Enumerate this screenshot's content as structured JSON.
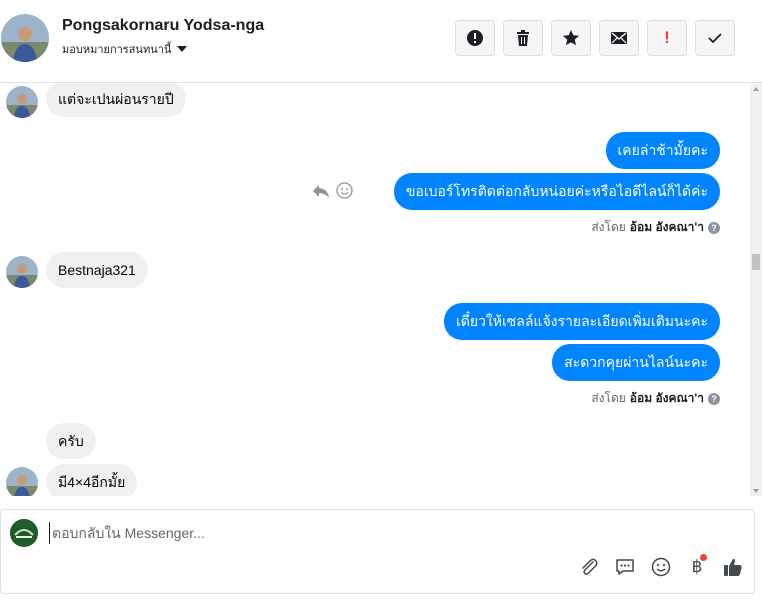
{
  "header": {
    "contact_name": "Pongsakornaru Yodsa-nga",
    "assign_label": "มอบหมายการสนทนานี้",
    "actions": [
      {
        "icon": "alert-circle-icon",
        "name": "report-button"
      },
      {
        "icon": "trash-icon",
        "name": "delete-button"
      },
      {
        "icon": "star-icon",
        "name": "star-button"
      },
      {
        "icon": "envelope-icon",
        "name": "mark-unread-button"
      },
      {
        "icon": "exclamation-icon",
        "name": "spam-button",
        "label": "!"
      },
      {
        "icon": "check-icon",
        "name": "done-button"
      }
    ]
  },
  "thread": {
    "messages": [
      {
        "dir": "in",
        "text": "แต่จะเปนผ่อนรายปี"
      },
      {
        "dir": "out",
        "text": "เคยล่าช้ามั้ยคะ"
      },
      {
        "dir": "out",
        "text": "ขอเบอร์โทรติดต่อกลับหน่อยค่ะหรือไอดีไลน์ก็ได้ค่ะ"
      },
      {
        "dir": "in",
        "text": "Bestnaja321"
      },
      {
        "dir": "out",
        "text": "เดี๋ยวให้เซลล์แจ้งรายละเอียดเพิ่มเติมนะคะ"
      },
      {
        "dir": "out",
        "text": "สะดวกคุยผ่านไลน์นะคะ"
      },
      {
        "dir": "in",
        "text": "ครับ"
      },
      {
        "dir": "in",
        "text": "มี4×4อีกมั้ย"
      }
    ],
    "sent_by": {
      "prefix": "ส่งโดย",
      "name": "อ้อม อังคณา'า"
    },
    "sent_by_2": {
      "prefix": "ส่งโดย",
      "name": "อ้อม อังคณา'า"
    },
    "help_glyph": "?"
  },
  "composer": {
    "placeholder": "ตอบกลับใน Messenger...",
    "tools": [
      "paperclip-icon",
      "saved-replies-icon",
      "emoji-icon",
      "baht-payment-icon",
      "thumbs-up-icon"
    ],
    "baht_symbol": "฿"
  },
  "colors": {
    "outgoing_bubble": "#0084ff",
    "incoming_bubble": "#f0f0f0",
    "accent": "#0084ff"
  }
}
